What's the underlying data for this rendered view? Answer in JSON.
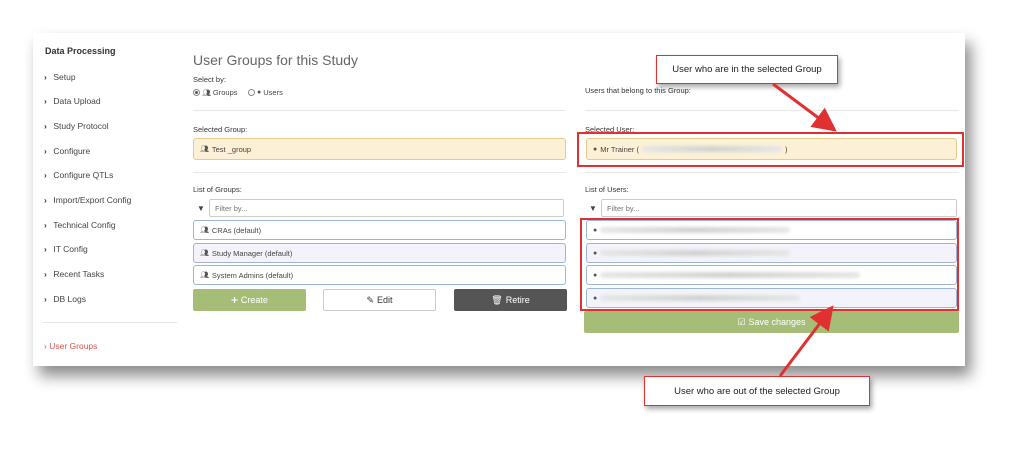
{
  "sidebar": {
    "title": "Data Processing",
    "items": [
      {
        "label": "Setup"
      },
      {
        "label": "Data Upload"
      },
      {
        "label": "Study Protocol"
      },
      {
        "label": "Configure"
      },
      {
        "label": "Configure QTLs"
      },
      {
        "label": "Import/Export Config"
      },
      {
        "label": "Technical Config"
      },
      {
        "label": "IT Config"
      },
      {
        "label": "Recent Tasks"
      },
      {
        "label": "DB Logs"
      }
    ],
    "active": "User Groups"
  },
  "main": {
    "title": "User Groups for this Study",
    "select_by_label": "Select by:",
    "radio_groups": "Groups",
    "radio_users": "Users",
    "selected_group_label": "Selected Group:",
    "selected_group_value": "Test _group",
    "list_groups_label": "List of Groups:",
    "filter_placeholder": "Filter by...",
    "groups": [
      "CRAs (default)",
      "Study Manager (default)",
      "System Admins (default)"
    ],
    "buttons": {
      "create": "Create",
      "edit": "Edit",
      "retire": "Retire"
    }
  },
  "right": {
    "users_in_group_label": "Users that belong to this Group:",
    "selected_user_label": "Selected User:",
    "selected_user_value": "Mr Trainer (",
    "selected_user_suffix": ")",
    "list_users_label": "List of Users:",
    "filter_placeholder": "Filter by...",
    "save_label": "Save changes"
  },
  "callouts": {
    "top": "User who are in the selected Group",
    "bottom": "User who are out of the selected Group"
  },
  "colors": {
    "active_link": "#d9534f",
    "create_button": "#a6bd77",
    "retire_button": "#555555",
    "selected_field_bg": "#fcf1d6",
    "annotation_red": "#e03030"
  }
}
